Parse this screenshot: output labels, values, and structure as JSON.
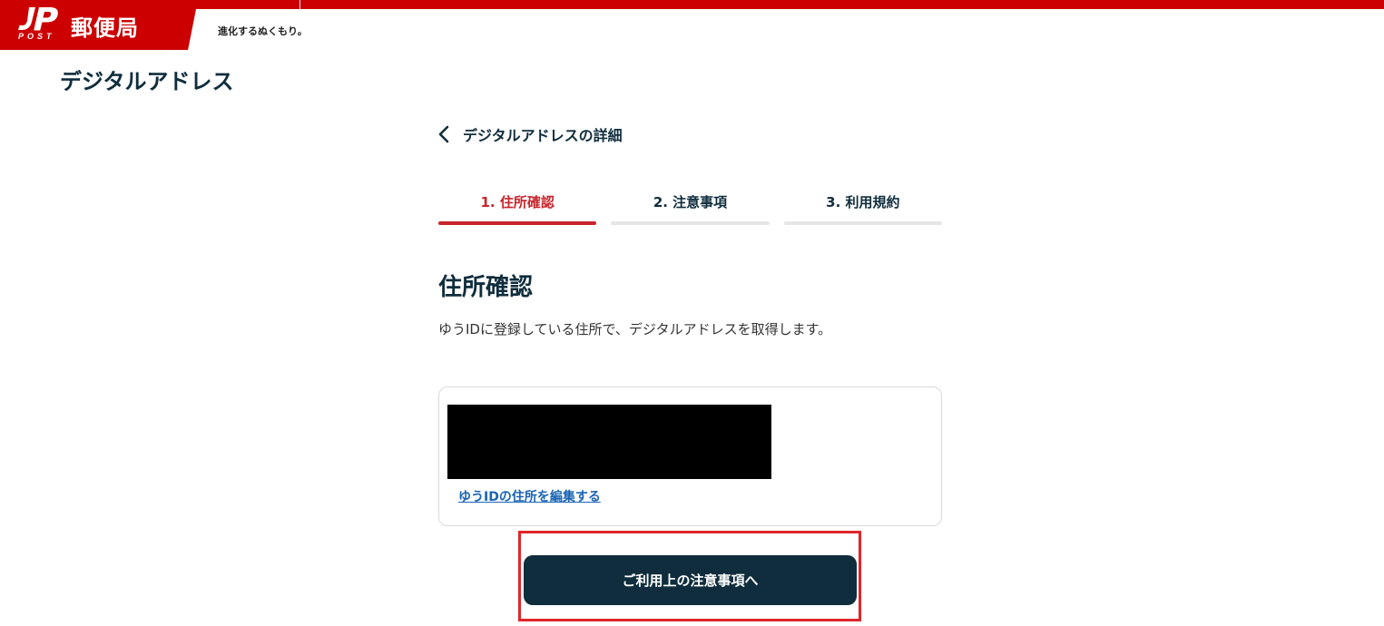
{
  "header": {
    "logo_post": "POST",
    "logo_name": "郵便局",
    "tagline": "進化するぬくもり。",
    "brand_color": "#cc0000"
  },
  "service_title": "デジタルアドレス",
  "back_link": {
    "label": "デジタルアドレスの詳細",
    "icon": "chevron-left-icon"
  },
  "steps": [
    {
      "label": "1. 住所確認",
      "active": true
    },
    {
      "label": "2. 注意事項",
      "active": false
    },
    {
      "label": "3. 利用規約",
      "active": false
    }
  ],
  "section": {
    "title": "住所確認",
    "description": "ゆうIDに登録している住所で、デジタルアドレスを取得します。"
  },
  "address_card": {
    "edit_link": "ゆうIDの住所を編集する"
  },
  "cta": {
    "label": "ご利用上の注意事項へ"
  },
  "colors": {
    "accent": "#c8242b",
    "primary_dark": "#0f2d3c",
    "link": "#1a64b4"
  }
}
